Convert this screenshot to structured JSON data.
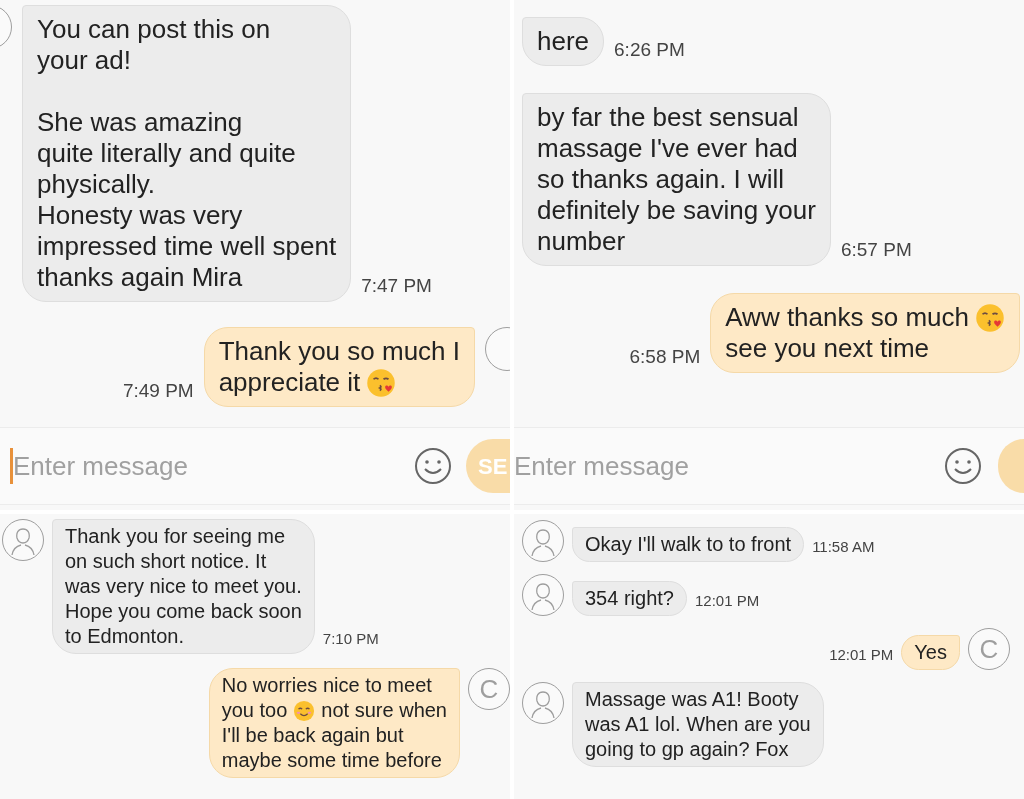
{
  "panels": [
    {
      "messages": [
        {
          "kind": "received",
          "avatar": true,
          "time": "7:47 PM",
          "paragraphs": [
            [
              [
                {
                  "kind": "text",
                  "text": "You can post this on"
                }
              ],
              [
                {
                  "kind": "text",
                  "text": "your ad!"
                }
              ]
            ],
            [
              [
                {
                  "kind": "text",
                  "text": "She was amazing"
                }
              ],
              [
                {
                  "kind": "text",
                  "text": "quite literally and quite"
                }
              ],
              [
                {
                  "kind": "text",
                  "text": "physically."
                }
              ],
              [
                {
                  "kind": "text",
                  "text": "Honesty was very"
                }
              ],
              [
                {
                  "kind": "text",
                  "text": "impressed time well spent"
                }
              ],
              [
                {
                  "kind": "text",
                  "text": "thanks again Mira"
                }
              ]
            ]
          ]
        },
        {
          "kind": "sent",
          "avatar": true,
          "time": "7:49 PM",
          "paragraphs": [
            [
              [
                {
                  "kind": "text",
                  "text": "Thank you so much I"
                }
              ],
              [
                {
                  "kind": "text",
                  "text": "appreciate it"
                },
                {
                  "kind": "kiss_emoji"
                }
              ]
            ]
          ]
        }
      ],
      "composer": {
        "placeholder": "Enter message",
        "focused": true,
        "send_label": "SE"
      }
    },
    {
      "messages": [
        {
          "kind": "received",
          "avatar": false,
          "time": "6:26 PM",
          "paragraphs": [
            [
              [
                {
                  "kind": "text",
                  "text": "here"
                }
              ]
            ]
          ]
        },
        {
          "kind": "received",
          "avatar": false,
          "time": "6:57 PM",
          "paragraphs": [
            [
              [
                {
                  "kind": "text",
                  "text": "by far the best sensual"
                }
              ],
              [
                {
                  "kind": "text",
                  "text": "massage I've ever had"
                }
              ],
              [
                {
                  "kind": "text",
                  "text": "so thanks again. I will"
                }
              ],
              [
                {
                  "kind": "text",
                  "text": "definitely be saving your"
                }
              ],
              [
                {
                  "kind": "text",
                  "text": "number"
                }
              ]
            ]
          ]
        },
        {
          "kind": "sent",
          "avatar": false,
          "time": "6:58 PM",
          "paragraphs": [
            [
              [
                {
                  "kind": "text",
                  "text": "Aww thanks so much"
                },
                {
                  "kind": "kiss_emoji"
                }
              ],
              [
                {
                  "kind": "text",
                  "text": "see you next time"
                }
              ]
            ]
          ]
        }
      ],
      "composer": {
        "placeholder": "Enter message",
        "focused": false
      }
    },
    {
      "messages": [
        {
          "kind": "received",
          "avatar": true,
          "time": "7:10 PM",
          "paragraphs": [
            [
              [
                {
                  "kind": "text",
                  "text": "Thank you for seeing me"
                }
              ],
              [
                {
                  "kind": "text",
                  "text": "on such short notice. It"
                }
              ],
              [
                {
                  "kind": "text",
                  "text": "was very nice to meet you."
                }
              ],
              [
                {
                  "kind": "text",
                  "text": "Hope you come back soon"
                }
              ],
              [
                {
                  "kind": "text",
                  "text": "to Edmonton."
                }
              ]
            ]
          ]
        },
        {
          "kind": "sent",
          "avatar": true,
          "avatar_letter": "C",
          "paragraphs": [
            [
              [
                {
                  "kind": "text",
                  "text": "No worries nice to meet"
                }
              ],
              [
                {
                  "kind": "text",
                  "text": "you too"
                },
                {
                  "kind": "smile_emoji"
                },
                {
                  "kind": "text",
                  "text": "not sure when"
                }
              ],
              [
                {
                  "kind": "text",
                  "text": "I'll be back again but"
                }
              ],
              [
                {
                  "kind": "text",
                  "text": "maybe some time before"
                }
              ]
            ]
          ]
        }
      ]
    },
    {
      "messages": [
        {
          "kind": "received",
          "avatar": true,
          "time": "11:58 AM",
          "paragraphs": [
            [
              [
                {
                  "kind": "text",
                  "text": "Okay I'll walk to to front"
                }
              ]
            ]
          ]
        },
        {
          "kind": "received",
          "avatar": true,
          "time": "12:01 PM",
          "paragraphs": [
            [
              [
                {
                  "kind": "text",
                  "text": "354 right?"
                }
              ]
            ]
          ]
        },
        {
          "kind": "sent",
          "avatar": true,
          "avatar_letter": "C",
          "time": "12:01 PM",
          "paragraphs": [
            [
              [
                {
                  "kind": "text",
                  "text": "Yes"
                }
              ]
            ]
          ]
        },
        {
          "kind": "received",
          "avatar": true,
          "paragraphs": [
            [
              [
                {
                  "kind": "text",
                  "text": "Massage was A1! Booty"
                }
              ],
              [
                {
                  "kind": "text",
                  "text": "was A1 lol. When are you"
                }
              ],
              [
                {
                  "kind": "text",
                  "text": "going to gp again? Fox"
                }
              ]
            ]
          ]
        }
      ]
    }
  ]
}
